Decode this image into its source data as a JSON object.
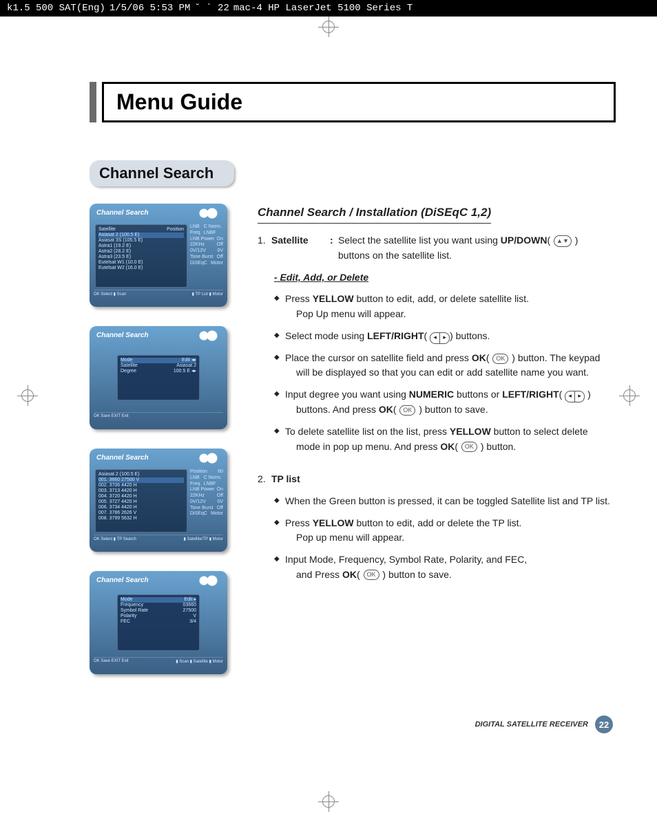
{
  "print_header": {
    "job": "k1.5 500 SAT(Eng)",
    "date": "1/5/06 5:53 PM",
    "page_marker": "˘   `   22",
    "printer": "mac-4 HP LaserJet 5100 Series   T"
  },
  "menu_guide": "Menu Guide",
  "section_title": "Channel Search",
  "subheading": "Channel Search / Installation (DiSEqC 1,2)",
  "satellite": {
    "num": "1.",
    "label": "Satellite",
    "line1_a": "Select the satellite list you want using ",
    "line1_b": "UP/DOWN",
    "line2": "buttons on the satellite list."
  },
  "edit_add": "- Edit, Add, or Delete",
  "bul1": {
    "a": "Press ",
    "b": "YELLOW",
    "c": " button to edit, add, or delete satellite list.",
    "d": "Pop Up menu will appear."
  },
  "bul2": {
    "a": "Select mode using ",
    "b": "LEFT/RIGHT",
    "c": ") buttons."
  },
  "bul3": {
    "a": "Place the cursor on satellite field and press ",
    "b": "OK",
    "c": " ) button. The keypad",
    "d": "will be displayed so that you can edit or add satellite name you want."
  },
  "bul4": {
    "a": "Input degree you want using ",
    "b": "NUMERIC",
    "c": " buttons or ",
    "d": "LEFT/RIGHT",
    "e": "buttons. And press ",
    "f": "OK",
    "g": " ) button to save."
  },
  "bul5": {
    "a": "To delete satellite list on the list, press ",
    "b": "YELLOW",
    "c": " button to select delete",
    "d": "mode in pop up menu. And press ",
    "e": "OK",
    "f": " ) button."
  },
  "tp": {
    "num": "2.",
    "label": "TP list",
    "b1": "When the Green button is pressed, it can be toggled Satellite list and TP list.",
    "b2a": "Press ",
    "b2b": "YELLOW",
    "b2c": " button to edit, add or delete the TP list.",
    "b2d": "Pop up menu will appear.",
    "b3a": "Input Mode, Frequency, Symbol Rate, Polarity, and FEC,",
    "b3b": "and Press ",
    "b3c": "OK",
    "b3d": " ) button to save."
  },
  "footer": {
    "label": "DIGITAL SATELLITE RECEIVER",
    "page": "22"
  },
  "thumbs": {
    "header": "Channel Search",
    "t1": {
      "left": [
        {
          "l": "Satellite",
          "r": "Position"
        },
        {
          "l": "Asiasat 2 (100.5 E)",
          "r": ""
        },
        {
          "l": "Asiasat 3S (105.5 E)",
          "r": ""
        },
        {
          "l": "Astra1 (19.2 E)",
          "r": ""
        },
        {
          "l": "Astra2 (28.2 E)",
          "r": ""
        },
        {
          "l": "Astra3 (23.5 E)",
          "r": ""
        },
        {
          "l": "Eutelsat W1 (10.0 E)",
          "r": ""
        },
        {
          "l": "Eutelsat W2 (16.0 E)",
          "r": ""
        }
      ],
      "right": [
        {
          "l": "LNB Freq.",
          "r": "C Norm. LNBF"
        },
        {
          "l": "LNB Power",
          "r": "On"
        },
        {
          "l": "22KHz",
          "r": "Off"
        },
        {
          "l": "0V/12V",
          "r": "0V"
        },
        {
          "l": "Tone Burst",
          "r": "Off"
        },
        {
          "l": "DiSEqC",
          "r": "Motor"
        }
      ],
      "footL": "OK Select      ▮ Scan",
      "footR": "▮ TP List   ▮ Motor"
    },
    "t2": {
      "popup": [
        {
          "l": "Mode",
          "r": "Edit  ◂▸"
        },
        {
          "l": "Satellite",
          "r": "Asiasat 2"
        },
        {
          "l": "Degree",
          "r": "100.5 E  ◂▸"
        }
      ],
      "footL": "OK Save   EXIT Exit",
      "rightSame": true
    },
    "t3": {
      "left": [
        {
          "l": "Asiasat 2 (100.5 E)",
          "r": ""
        },
        {
          "l": "001. 3660  27500  V",
          "r": ""
        },
        {
          "l": "002. 3706  4420  H",
          "r": ""
        },
        {
          "l": "003. 3713  4420  H",
          "r": ""
        },
        {
          "l": "004. 3720  4420  H",
          "r": ""
        },
        {
          "l": "005. 3727  4420  H",
          "r": ""
        },
        {
          "l": "006. 3734  4420  H",
          "r": ""
        },
        {
          "l": "007. 3786  2626  V",
          "r": ""
        },
        {
          "l": "008. 3799  5632  H",
          "r": ""
        }
      ],
      "right": [
        {
          "l": "Position",
          "r": "60"
        },
        {
          "l": "LNB Freq.",
          "r": "C Norm. LNBF"
        },
        {
          "l": "LNB Power",
          "r": "On"
        },
        {
          "l": "22KHz",
          "r": "Off"
        },
        {
          "l": "0V/12V",
          "r": "0V"
        },
        {
          "l": "Tone Burst",
          "r": "Off"
        },
        {
          "l": "DiSEqC",
          "r": "Motor"
        }
      ],
      "footL": "OK Select   ▮ TP Search",
      "footR": "▮ Satellite/TP   ▮ Motor"
    },
    "t4": {
      "popup": [
        {
          "l": "Mode",
          "r": "Edit  ▸"
        },
        {
          "l": "Frequency",
          "r": "03660"
        },
        {
          "l": "Symbol Rate",
          "r": "27500"
        },
        {
          "l": "Polarity",
          "r": "V"
        },
        {
          "l": "FEC",
          "r": "3/4"
        }
      ],
      "footL": "OK Save   EXIT Exit",
      "footR": "▮ Scan   ▮ Satellite   ▮ Motor"
    }
  }
}
